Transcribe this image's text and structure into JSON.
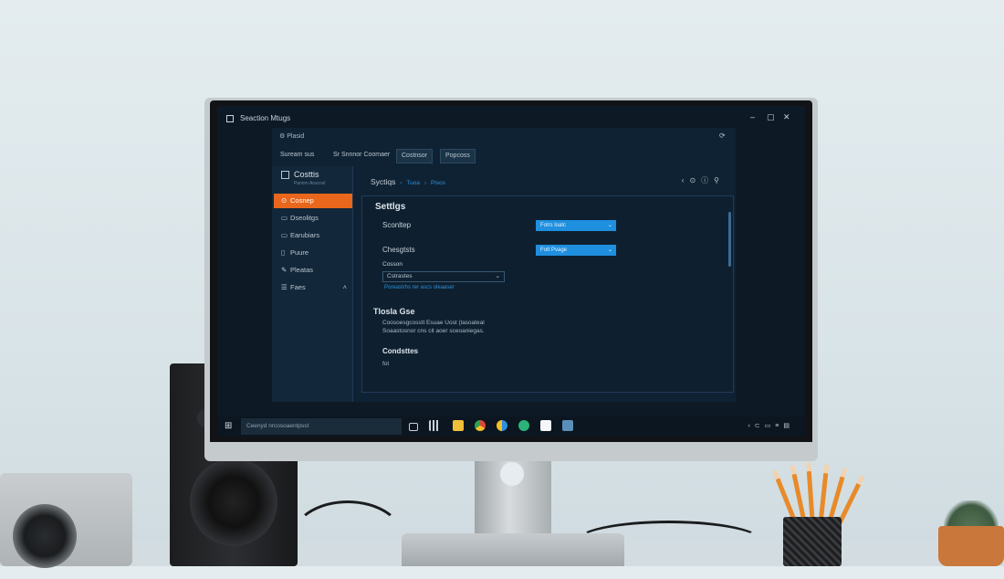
{
  "window": {
    "title": "Seaction Mtugs",
    "row1": "Plasid",
    "controls": [
      "–",
      "▢",
      "✕"
    ]
  },
  "toolbar": {
    "items": [
      "Suream sus",
      "Sr Snnnor Coomaer",
      "Costnsor",
      "Popcoss"
    ]
  },
  "sidebar": {
    "brand": "Costtis",
    "brand_sub": "Panmn  Aoscosl",
    "items": [
      {
        "label": "Cosnep",
        "active": true
      },
      {
        "label": "Dseolitgs",
        "active": false
      },
      {
        "label": "Earubiars",
        "active": false
      },
      {
        "label": "Puure",
        "active": false
      },
      {
        "label": "Pleatas",
        "active": false
      },
      {
        "label": "Faes",
        "active": false
      }
    ]
  },
  "content": {
    "crumb_main": "Syctiqs",
    "crumb_links": [
      "Tuoa",
      "Pisos"
    ],
    "panel_title": "Settlgs",
    "field1_label": "Sconltep",
    "field1_value": "Fotrs loatc",
    "field2_label": "Chesgtsts",
    "field2_value": "Fott Pvage",
    "field3_label": "Cosson",
    "field3_value": "Cstrastes",
    "help_link": "Poreastrhs rer ascs oleaaser",
    "section1_title": "Tlosla Gse",
    "section1_text": "Coosoesgcosstt Esuae Uost (lasoateal\nSoaastosnor cns cit aoer sceoaniegas.",
    "section2_title": "Condsttes",
    "section2_text": "fot"
  },
  "taskbar": {
    "search_placeholder": "Ceenyd nrcosoaentpsst"
  }
}
